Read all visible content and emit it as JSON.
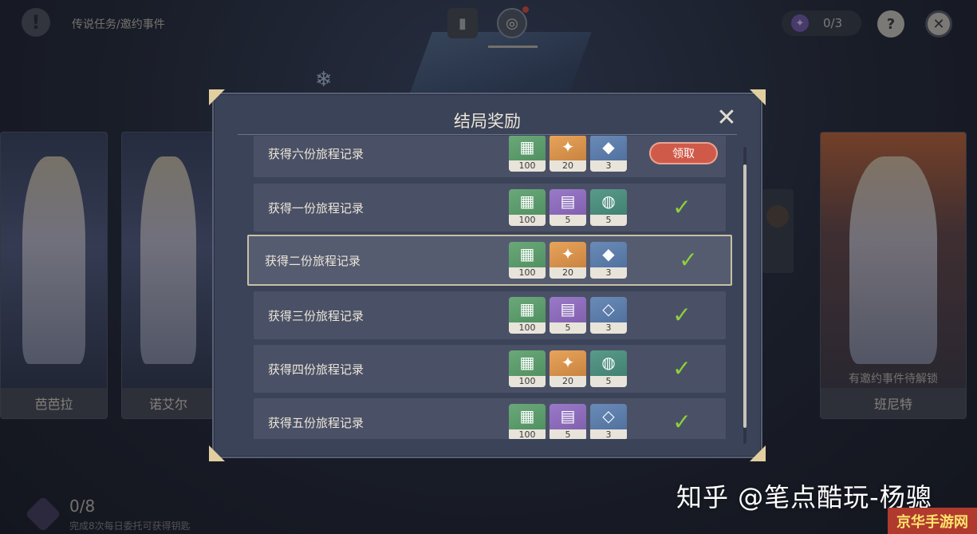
{
  "topbar": {
    "title": "传说任务/邀约事件",
    "counter": "0/3",
    "help_label": "?",
    "close_label": "✕"
  },
  "cards": [
    {
      "name": "芭芭拉"
    },
    {
      "name": "诺艾尔"
    },
    {
      "name": "班尼特",
      "lock_text": "有邀约事件待解锁"
    }
  ],
  "bottom": {
    "count": "0/8",
    "desc": "完成8次每日委托可获得钥匙"
  },
  "modal": {
    "title": "结局奖励",
    "close_label": "✕",
    "claim_label": "领取",
    "rows": [
      {
        "label": "获得六份旅程记录",
        "items": [
          {
            "type": "旅程记录",
            "count": "100",
            "color": "green"
          },
          {
            "type": "原石",
            "count": "20",
            "color": "orange"
          },
          {
            "type": "精锻用魔矿",
            "count": "3",
            "color": "blue"
          }
        ],
        "status": "claim"
      },
      {
        "label": "获得一份旅程记录",
        "items": [
          {
            "type": "旅程记录",
            "count": "100",
            "color": "green"
          },
          {
            "type": "书",
            "count": "5",
            "color": "purple"
          },
          {
            "type": "料理",
            "count": "5",
            "color": "teal"
          }
        ],
        "status": "done"
      },
      {
        "label": "获得二份旅程记录",
        "items": [
          {
            "type": "旅程记录",
            "count": "100",
            "color": "green"
          },
          {
            "type": "原石",
            "count": "20",
            "color": "orange"
          },
          {
            "type": "精锻用魔矿",
            "count": "3",
            "color": "blue"
          }
        ],
        "status": "done"
      },
      {
        "label": "获得三份旅程记录",
        "items": [
          {
            "type": "旅程记录",
            "count": "100",
            "color": "green"
          },
          {
            "type": "书",
            "count": "5",
            "color": "purple"
          },
          {
            "type": "水晶",
            "count": "3",
            "color": "blue"
          }
        ],
        "status": "done"
      },
      {
        "label": "获得四份旅程记录",
        "items": [
          {
            "type": "旅程记录",
            "count": "100",
            "color": "green"
          },
          {
            "type": "原石",
            "count": "20",
            "color": "orange"
          },
          {
            "type": "料理",
            "count": "5",
            "color": "teal"
          }
        ],
        "status": "done"
      },
      {
        "label": "获得五份旅程记录",
        "items": [
          {
            "type": "旅程记录",
            "count": "100",
            "color": "green"
          },
          {
            "type": "书",
            "count": "5",
            "color": "purple"
          },
          {
            "type": "水晶",
            "count": "3",
            "color": "blue"
          }
        ],
        "status": "done"
      }
    ]
  },
  "watermarks": {
    "zhihu": "知乎 @笔点酷玩-杨骢",
    "site": "京华手游网"
  }
}
